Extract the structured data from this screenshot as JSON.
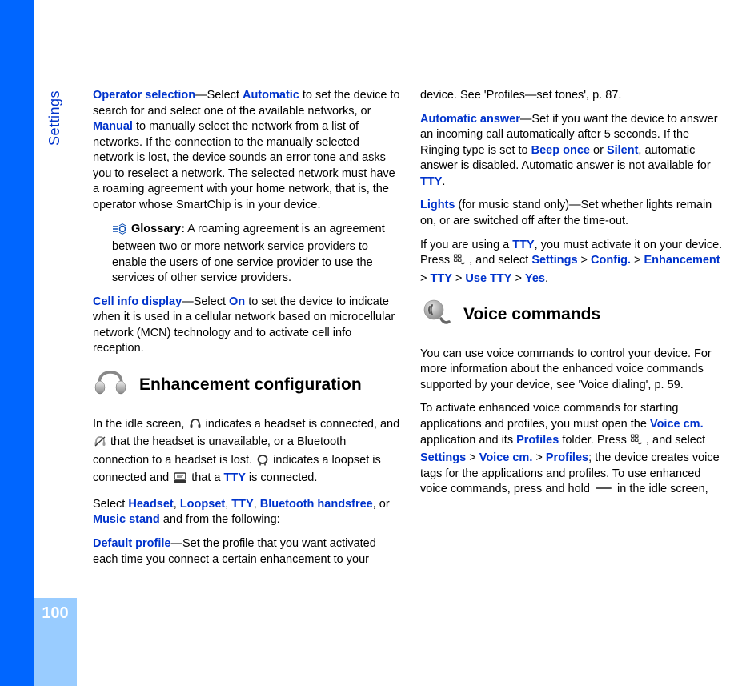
{
  "side_label": "Settings",
  "page_number": "100",
  "left": {
    "operator_selection_lead": "Operator selection",
    "operator_selection_text1": "—Select ",
    "operator_selection_auto": "Automatic",
    "operator_selection_text2": " to set the device to search for and select one of the available networks, or ",
    "operator_selection_manual": "Manual",
    "operator_selection_text3": " to manually select the network from a list of networks. If the connection to the manually selected network is lost, the device sounds an error tone and asks you to reselect a network. The selected network must have a roaming agreement with your home network, that is, the operator whose SmartChip is in your device.",
    "glossary_label": "Glossary:",
    "glossary_text": " A roaming agreement is an agreement between two or more network service providers to enable the users of one service provider to use the services of other service providers.",
    "cell_info_lead": "Cell info display",
    "cell_info_text1": "—Select ",
    "cell_info_on": "On",
    "cell_info_text2": " to set the device to indicate when it is used in a cellular network based on microcellular network (MCN) technology and to activate cell info reception.",
    "enh_heading": "Enhancement configuration",
    "idle_text1": "In the idle screen, ",
    "idle_text2": " indicates a headset is connected, and ",
    "idle_text3": " that the headset is unavailable, or a Bluetooth connection to a headset is lost. ",
    "idle_text4": " indicates a loopset is connected and ",
    "idle_text5": " that a ",
    "idle_tty": "TTY",
    "idle_text6": " is connected.",
    "select_text1": "Select ",
    "select_headsetA": "Headset",
    "select_sep1": ", ",
    "select_loopset": "Loopset",
    "select_sep2": ", ",
    "select_tty": "TTY",
    "select_sep3": ", ",
    "select_bt": "Bluetooth handsfree",
    "select_sep4": ", or ",
    "select_music": "Music stand",
    "select_text2": " and from the following:"
  },
  "right": {
    "default_profile_lead": "Default profile",
    "default_profile_text": "—Set the profile that you want activated each time you connect a certain enhancement to your device. See 'Profiles—set tones', p. 87.",
    "auto_answer_lead": "Automatic answer",
    "auto_answer_text1": "—Set if you want the device to answer an incoming call automatically after 5 seconds. If the Ringing type is set to ",
    "auto_answer_beep": "Beep once",
    "auto_answer_or": " or ",
    "auto_answer_silent": "Silent",
    "auto_answer_text2": ", automatic answer is disabled. Automatic answer is not available for ",
    "auto_answer_tty": "TTY",
    "auto_answer_period": ".",
    "lights_lead": "Lights",
    "lights_text": " (for music stand only)—Set whether lights remain on, or are switched off after the time-out.",
    "tty_use_text1": "If you are using a ",
    "tty_use_tty": "TTY",
    "tty_use_text2": ", you must activate it on your device. Press ",
    "tty_use_text3": " , and select ",
    "tty_path_settings": "Settings",
    "tty_path_config": "Config.",
    "tty_path_enh": "Enhancement",
    "tty_path_tty": "TTY",
    "tty_path_use": "Use TTY",
    "tty_path_yes": "Yes",
    "gt": ">",
    "period": ".",
    "voice_heading": "Voice commands",
    "voice_intro": "You can use voice commands to control your device. For more information about the enhanced voice commands supported by your device, see 'Voice dialing', p. 59.",
    "activate_text1": "To activate enhanced voice commands for starting applications and profiles, you must open the ",
    "activate_voicecm": "Voice cm.",
    "activate_text2": " application and its ",
    "activate_profiles1": "Profiles",
    "activate_text3": " folder. Press ",
    "activate_text4": " , and select ",
    "activate_settings": "Settings",
    "activate_voicecm2": "Voice cm.",
    "activate_profiles2": "Profiles",
    "activate_text5": "; the device creates voice tags for the applications and profiles. To use enhanced voice commands, press and hold ",
    "activate_text6": " in the idle screen,"
  }
}
